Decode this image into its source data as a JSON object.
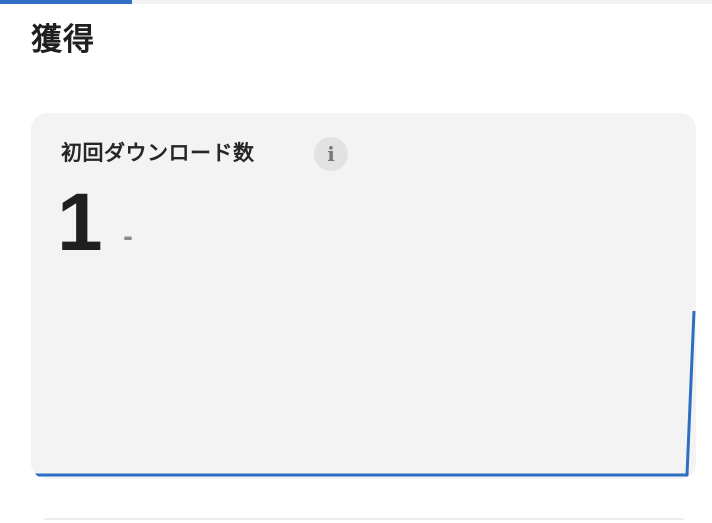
{
  "header": {
    "progress_fraction": 0.185,
    "accent_color": "#2e6fc3"
  },
  "section": {
    "title": "獲得"
  },
  "metric_card": {
    "label": "初回ダウンロード数",
    "info_icon": "info-icon",
    "info_glyph": "i",
    "value": "1",
    "change": "-",
    "line_color": "#2e6fc3",
    "background_color": "#f3f3f3"
  }
}
